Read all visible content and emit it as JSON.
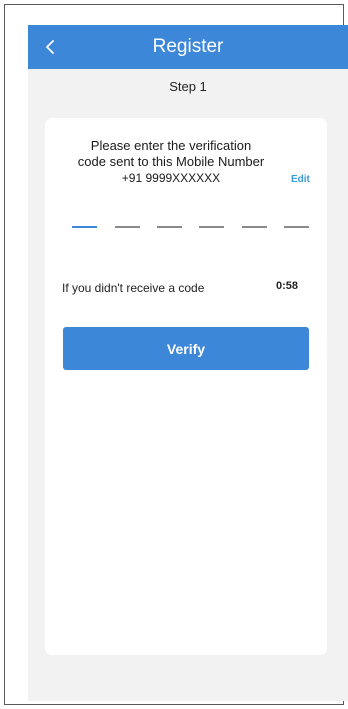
{
  "header": {
    "title": "Register",
    "back_icon": "chevron-left-icon"
  },
  "step_label": "Step 1",
  "verification": {
    "message_line_1": "Please enter the verification",
    "message_line_2": "code sent to this Mobile Number",
    "phone_number": "+91 9999XXXXXX",
    "edit_label": "Edit",
    "code_length": 6,
    "active_slot": 1
  },
  "resend": {
    "prompt": "If you didn't receive a code",
    "timer": "0:58"
  },
  "verify_button_label": "Verify",
  "colors": {
    "primary": "#3d87d8",
    "link": "#3d9bd6",
    "background": "#f2f2f2",
    "card": "#ffffff"
  }
}
